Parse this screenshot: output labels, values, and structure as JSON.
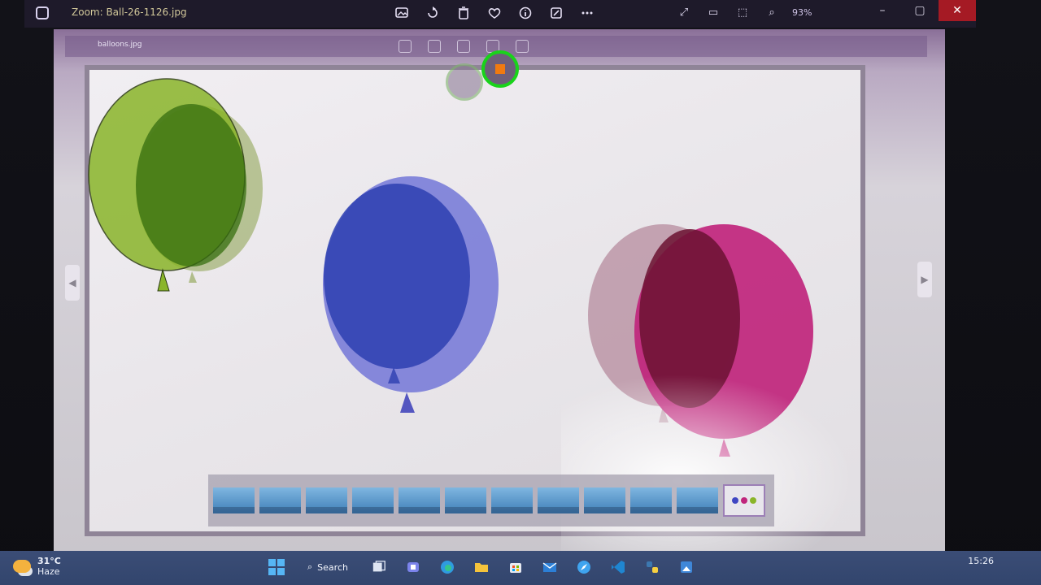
{
  "titlebar": {
    "title": "Zoom: Ball-26-1126.jpg",
    "zoom": "93%"
  },
  "inner_window": {
    "file": "balloons.jpg"
  },
  "taskbar": {
    "weather_temp": "31°C",
    "weather_cond": "Haze",
    "search_label": "Search",
    "time": "15:26"
  },
  "icons": [
    "photo-app-icon",
    "view-icon",
    "rotate-icon",
    "delete-icon",
    "heart-icon",
    "info-icon",
    "edit-icon",
    "more-icon",
    "close-icon",
    "search-icon"
  ],
  "colors": {
    "accent_green": "#19d31a",
    "balloon_green": "#7fae2b",
    "balloon_blue": "#3f46c2",
    "balloon_magenta": "#c0257c",
    "taskbar": "#34476f"
  },
  "balloons": [
    {
      "name": "green"
    },
    {
      "name": "blue"
    },
    {
      "name": "magenta"
    }
  ]
}
